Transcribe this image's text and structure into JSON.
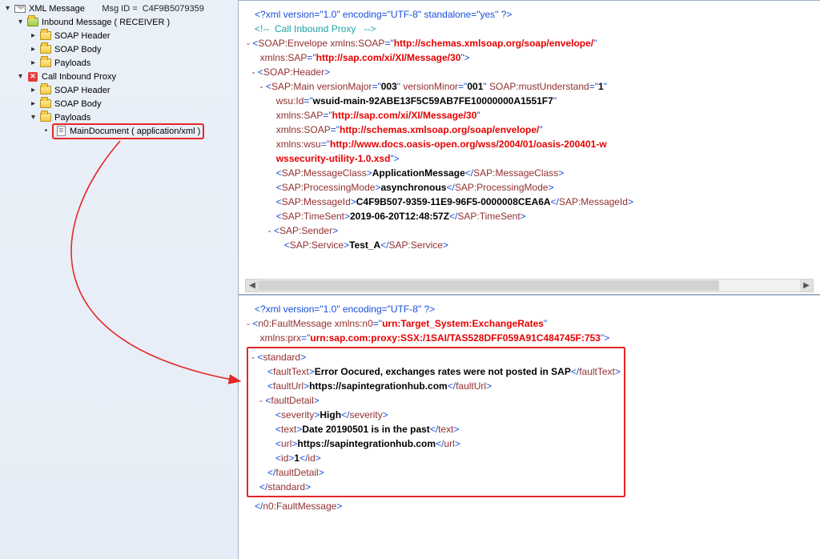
{
  "tree": {
    "root_label": "XML Message",
    "msgid_label": "Msg ID  =",
    "msgid_value": "C4F9B5079359",
    "inbound_label": "Inbound Message ( RECEIVER )",
    "soap_header": "SOAP Header",
    "soap_body": "SOAP Body",
    "payloads": "Payloads",
    "call_inbound_proxy": "Call Inbound Proxy",
    "main_document": "MainDocument ( application/xml )"
  },
  "xml_top": {
    "decl": "<?xml version=\"1.0\" encoding=\"UTF-8\" standalone=\"yes\" ?>",
    "comment": "<!--  Call Inbound Proxy   -->",
    "env_open_1": "SOAP:Envelope",
    "env_xmlns_soap_attr": "xmlns:SOAP",
    "env_xmlns_soap_val": "http://schemas.xmlsoap.org/soap/envelope/",
    "env_xmlns_sap_attr": "xmlns:SAP",
    "env_xmlns_sap_val": "http://sap.com/xi/XI/Message/30",
    "hdr_open": "SOAP:Header",
    "main_open": "SAP:Main",
    "versionMajor_attr": "versionMajor",
    "versionMajor_val": "003",
    "versionMinor_attr": "versionMinor",
    "versionMinor_val": "001",
    "mustUnderstand_attr": "SOAP:mustUnderstand",
    "mustUnderstand_val": "1",
    "wsu_id_attr": "wsu:Id",
    "wsu_id_val": "wsuid-main-92ABE13F5C59AB7FE10000000A1551F7",
    "xmlns_sap2_attr": "xmlns:SAP",
    "xmlns_sap2_val": "http://sap.com/xi/XI/Message/30",
    "xmlns_soap2_attr": "xmlns:SOAP",
    "xmlns_soap2_val": "http://schemas.xmlsoap.org/soap/envelope/",
    "xmlns_wsu_attr": "xmlns:wsu",
    "xmlns_wsu_val_a": "http://www.docs.oasis-open.org/wss/2004/01/oasis-200401-w",
    "xmlns_wsu_val_b": "wssecurity-utility-1.0.xsd",
    "msgclass_tag": "SAP:MessageClass",
    "msgclass_val": "ApplicationMessage",
    "procmode_tag": "SAP:ProcessingMode",
    "procmode_val": "asynchronous",
    "msgid_tag": "SAP:MessageId",
    "msgid_val": "C4F9B507-9359-11E9-96F5-0000008CEA6A",
    "timesent_tag": "SAP:TimeSent",
    "timesent_val": "2019-06-20T12:48:57Z",
    "sender_tag": "SAP:Sender",
    "service_tag": "SAP:Service",
    "service_val": "Test_A"
  },
  "xml_bottom": {
    "decl": "<?xml version=\"1.0\" encoding=\"UTF-8\" ?>",
    "fault_open": "n0:FaultMessage",
    "xmlns_n0_attr": "xmlns:n0",
    "xmlns_n0_val": "urn:Target_System:ExchangeRates",
    "xmlns_prx_attr": "xmlns:prx",
    "xmlns_prx_val": "urn:sap.com:proxy:SSX:/1SAI/TAS528DFF059A91C484745F:753",
    "standard_tag": "standard",
    "faulttext_tag": "faultText",
    "faulttext_val": "Error Oocured, exchanges rates were not posted in SAP",
    "faulturl_tag": "faultUrl",
    "faulturl_val": "https://sapintegrationhub.com",
    "faultdetail_tag": "faultDetail",
    "severity_tag": "severity",
    "severity_val": "High",
    "text_tag": "text",
    "text_val": "Date 20190501 is in the past",
    "url_tag": "url",
    "url_val": "https://sapintegrationhub.com",
    "id_tag": "id",
    "id_val": "1",
    "fault_close": "n0:FaultMessage"
  }
}
